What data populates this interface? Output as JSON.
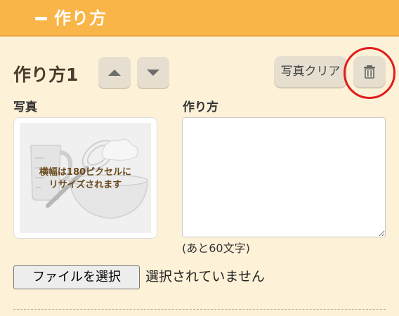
{
  "header": {
    "title": "作り方"
  },
  "step": {
    "title": "作り方1",
    "clear_photo_label": "写真クリア"
  },
  "photo": {
    "label": "写真",
    "placeholder_line1": "横幅は180ピクセルに",
    "placeholder_line2": "リサイズされます"
  },
  "method": {
    "label": "作り方",
    "value": "",
    "char_count": "(あと60文字)"
  },
  "file": {
    "button_label": "ファイルを選択",
    "status": "選択されていません"
  },
  "colors": {
    "header_bg": "#f9b548",
    "page_bg": "#fdf1d8",
    "button_bg": "#e6decf",
    "highlight_ring": "#e21b1b"
  }
}
